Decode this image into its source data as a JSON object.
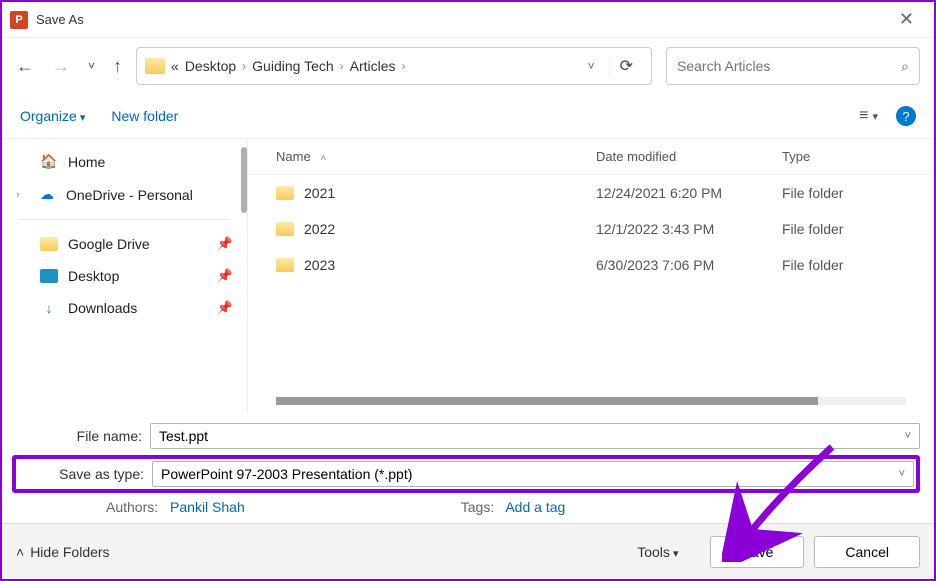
{
  "window": {
    "title": "Save As"
  },
  "breadcrumbs": {
    "root_glyph": "«",
    "items": [
      "Desktop",
      "Guiding Tech",
      "Articles"
    ]
  },
  "search": {
    "placeholder": "Search Articles"
  },
  "toolbar": {
    "organize": "Organize",
    "new_folder": "New folder"
  },
  "sidebar": {
    "home": "Home",
    "onedrive": "OneDrive - Personal",
    "gdrive": "Google Drive",
    "desktop": "Desktop",
    "downloads": "Downloads"
  },
  "columns": {
    "name": "Name",
    "date": "Date modified",
    "type": "Type"
  },
  "files": [
    {
      "name": "2021",
      "date": "12/24/2021 6:20 PM",
      "type": "File folder"
    },
    {
      "name": "2022",
      "date": "12/1/2022 3:43 PM",
      "type": "File folder"
    },
    {
      "name": "2023",
      "date": "6/30/2023 7:06 PM",
      "type": "File folder"
    }
  ],
  "form": {
    "file_name_label": "File name:",
    "file_name_value": "Test.ppt",
    "save_type_label": "Save as type:",
    "save_type_value": "PowerPoint 97-2003 Presentation (*.ppt)",
    "authors_label": "Authors:",
    "authors_value": "Pankil Shah",
    "tags_label": "Tags:",
    "tags_value": "Add a tag"
  },
  "footer": {
    "hide_folders": "Hide Folders",
    "tools": "Tools",
    "save": "Save",
    "cancel": "Cancel"
  }
}
